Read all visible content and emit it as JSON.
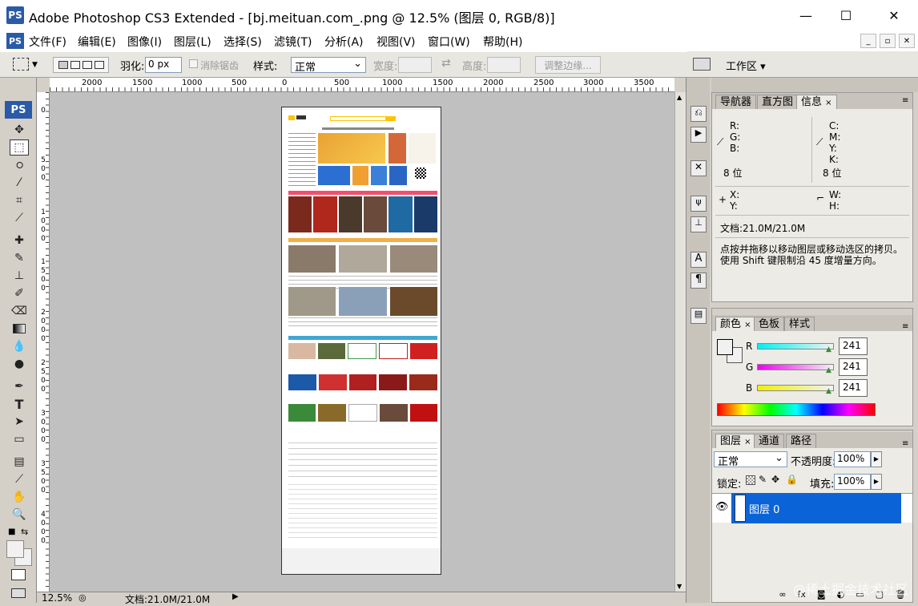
{
  "window": {
    "app_icon": "PS",
    "title": "Adobe Photoshop CS3 Extended - [bj.meituan.com_.png @ 12.5% (图层 0, RGB/8)]",
    "minimize": "—",
    "maximize": "☐",
    "close": "✕"
  },
  "menu": [
    "文件(F)",
    "编辑(E)",
    "图像(I)",
    "图层(L)",
    "选择(S)",
    "滤镜(T)",
    "分析(A)",
    "视图(V)",
    "窗口(W)",
    "帮助(H)"
  ],
  "mdi": {
    "min": "_",
    "restore": "▫",
    "close": "✕"
  },
  "options": {
    "feather_label": "羽化:",
    "feather_value": "0 px",
    "antialias_label": "消除锯齿",
    "style_label": "样式:",
    "style_value": "正常",
    "width_label": "宽度:",
    "height_label": "高度:",
    "refine_button": "调整边缘...",
    "workspace_button": "工作区 ▾"
  },
  "ruler_h": [
    "2000",
    "1500",
    "1000",
    "500",
    "0",
    "500",
    "1000",
    "1500",
    "2000",
    "2500",
    "3000",
    "3500"
  ],
  "ruler_v": [
    "0",
    "5",
    "0",
    "0",
    "1",
    "0",
    "0",
    "0",
    "1",
    "5",
    "0",
    "0",
    "2",
    "0",
    "0",
    "0",
    "2",
    "5",
    "0",
    "0",
    "3",
    "0",
    "0",
    "0",
    "3",
    "5",
    "0",
    "0",
    "4",
    "0",
    "0",
    "0"
  ],
  "status": {
    "zoom": "12.5%",
    "doc": "文档:21.0M/21.0M"
  },
  "nav_panel": {
    "tabs": [
      "导航器",
      "直方图",
      "信息"
    ],
    "r_label": "R:",
    "g_label": "G:",
    "b_label": "B:",
    "c_label": "C:",
    "m_label": "M:",
    "y_label": "Y:",
    "k_label": "K:",
    "bits_left": "8 位",
    "bits_right": "8 位",
    "x_label": "X:",
    "y2_label": "Y:",
    "w_label": "W:",
    "h_label": "H:",
    "doc_info": "文档:21.0M/21.0M",
    "hint_line1": "点按并拖移以移动图层或移动选区的拷贝。",
    "hint_line2": "使用 Shift 键限制沿 45 度增量方向。"
  },
  "color_panel": {
    "tabs": [
      "颜色",
      "色板",
      "样式"
    ],
    "r_label": "R",
    "g_label": "G",
    "b_label": "B",
    "r_value": "241",
    "g_value": "241",
    "b_value": "241"
  },
  "layers_panel": {
    "tabs": [
      "图层",
      "通道",
      "路径"
    ],
    "blend_mode": "正常",
    "opacity_label": "不透明度:",
    "opacity_value": "100%",
    "lock_label": "锁定:",
    "fill_label": "填充:",
    "fill_value": "100%",
    "layer_name": "图层 0"
  },
  "watermark": "@稀土掘金技术社区",
  "colors": {
    "accent_blue": "#0a64d8",
    "canvas_gray": "#c0c0c0",
    "panel_bg": "#d4d0c8"
  }
}
